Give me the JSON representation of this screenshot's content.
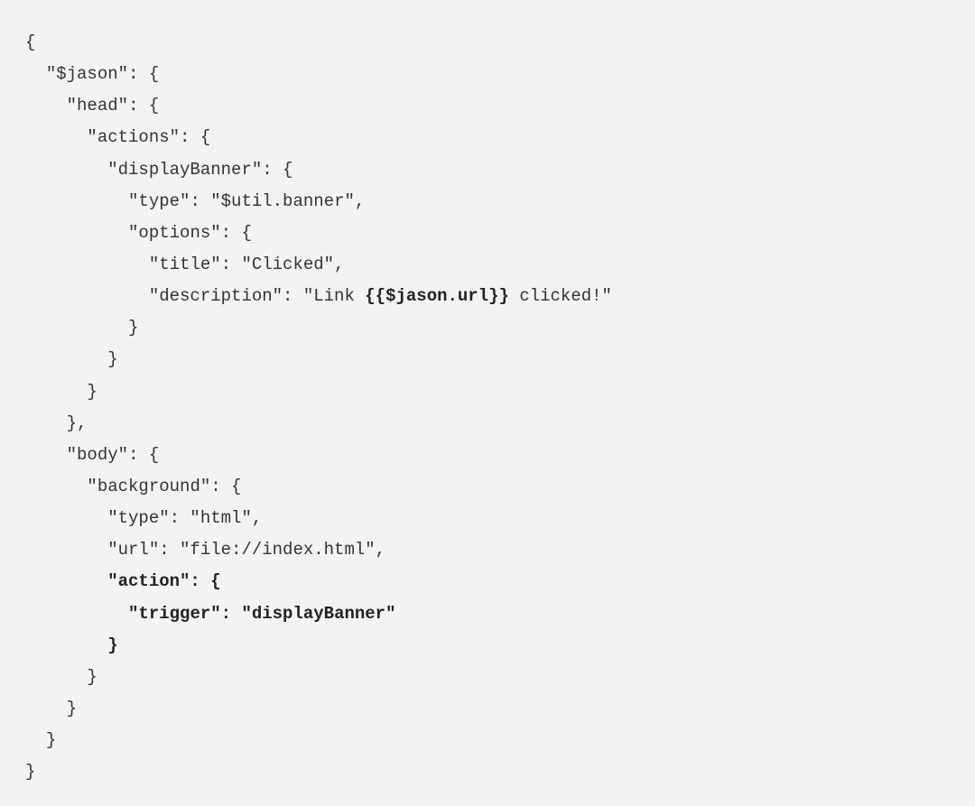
{
  "code": {
    "lines": [
      {
        "indent": 0,
        "text": "{",
        "bold": false
      },
      {
        "indent": 1,
        "text": "\"$jason\": {",
        "bold": false
      },
      {
        "indent": 2,
        "text": "\"head\": {",
        "bold": false
      },
      {
        "indent": 3,
        "text": "\"actions\": {",
        "bold": false
      },
      {
        "indent": 4,
        "text": "\"displayBanner\": {",
        "bold": false
      },
      {
        "indent": 5,
        "text": "\"type\": \"$util.banner\",",
        "bold": false
      },
      {
        "indent": 5,
        "text": "\"options\": {",
        "bold": false
      },
      {
        "indent": 6,
        "text": "\"title\": \"Clicked\",",
        "bold": false
      }
    ],
    "description_line": {
      "indent": 6,
      "prefix": "\"description\": \"Link ",
      "bold_part": "{{$jason.url}}",
      "suffix": " clicked!\""
    },
    "lines_after_desc": [
      {
        "indent": 5,
        "text": "}",
        "bold": false
      },
      {
        "indent": 4,
        "text": "}",
        "bold": false
      },
      {
        "indent": 3,
        "text": "}",
        "bold": false
      },
      {
        "indent": 2,
        "text": "},",
        "bold": false
      },
      {
        "indent": 2,
        "text": "\"body\": {",
        "bold": false
      },
      {
        "indent": 3,
        "text": "\"background\": {",
        "bold": false
      },
      {
        "indent": 4,
        "text": "\"type\": \"html\",",
        "bold": false
      },
      {
        "indent": 4,
        "text": "\"url\": \"file://index.html\",",
        "bold": false
      },
      {
        "indent": 4,
        "text": "\"action\": {",
        "bold": true
      },
      {
        "indent": 5,
        "text": "\"trigger\": \"displayBanner\"",
        "bold": true
      },
      {
        "indent": 4,
        "text": "}",
        "bold": true
      },
      {
        "indent": 3,
        "text": "}",
        "bold": false
      },
      {
        "indent": 2,
        "text": "}",
        "bold": false
      },
      {
        "indent": 1,
        "text": "}",
        "bold": false
      },
      {
        "indent": 0,
        "text": "}",
        "bold": false
      }
    ]
  }
}
